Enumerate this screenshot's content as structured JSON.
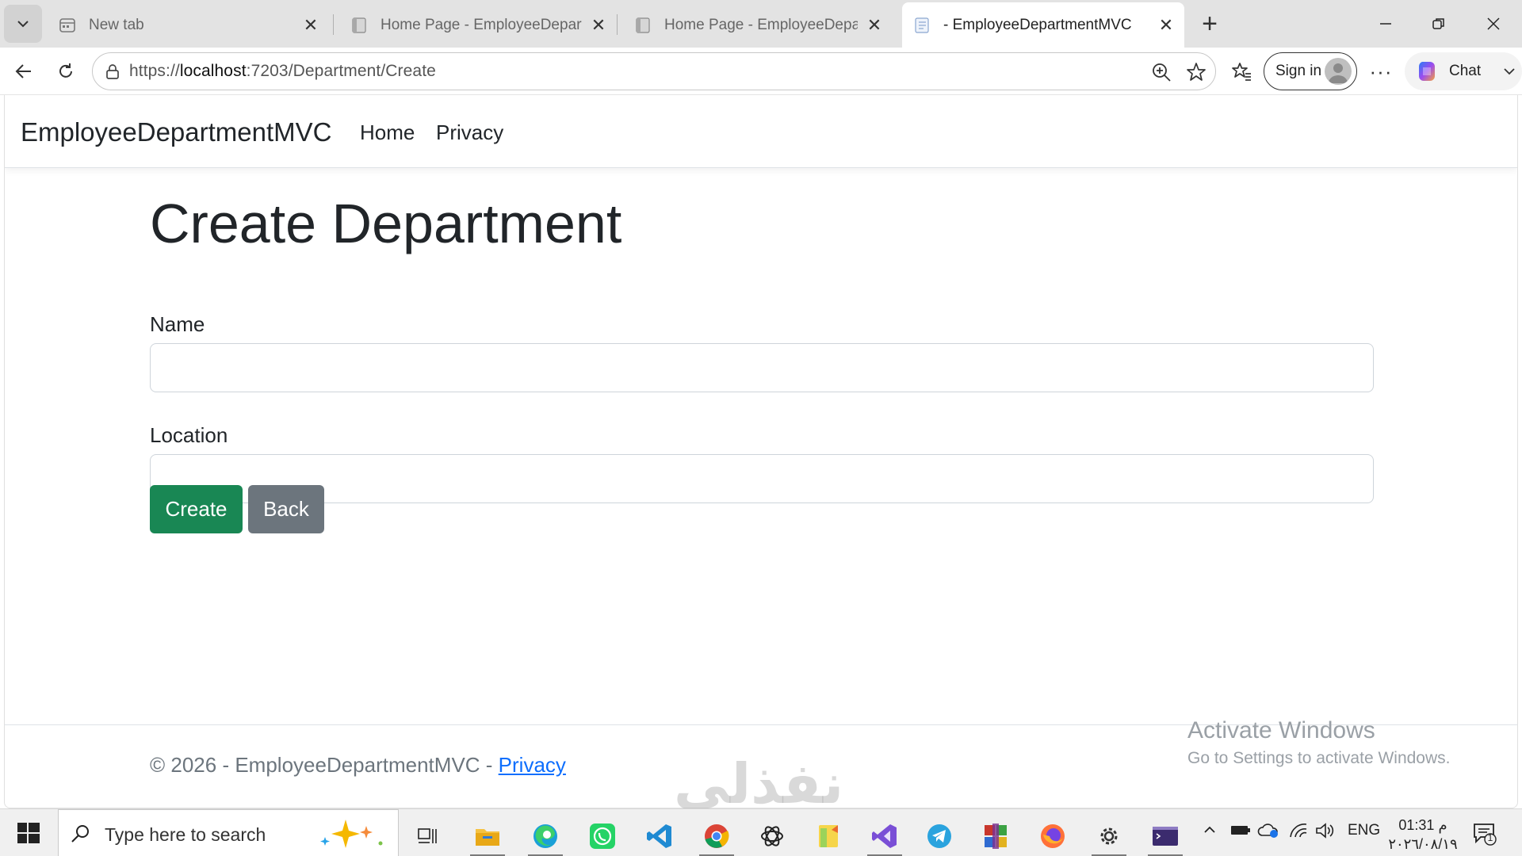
{
  "browser": {
    "tabs": [
      {
        "title": "New tab",
        "active": false
      },
      {
        "title": "Home Page - EmployeeDepartmentMVC",
        "active": false
      },
      {
        "title": "Home Page - EmployeeDepartmentMVC",
        "active": false
      },
      {
        "title": "- EmployeeDepartmentMVC",
        "active": true
      }
    ],
    "url_scheme": "https://",
    "url_host": "localhost",
    "url_rest": ":7203/Department/Create",
    "signin_label": "Sign in",
    "chat_label": "Chat"
  },
  "site": {
    "brand": "EmployeeDepartmentMVC",
    "nav": [
      {
        "label": "Home"
      },
      {
        "label": "Privacy"
      }
    ]
  },
  "form": {
    "title": "Create Department",
    "name_label": "Name",
    "name_value": "",
    "location_label": "Location",
    "location_value": "",
    "create_label": "Create",
    "back_label": "Back"
  },
  "footer": {
    "text": "© 2026 - EmployeeDepartmentMVC - ",
    "privacy_link": "Privacy"
  },
  "activation": {
    "title": "Activate Windows",
    "subtitle": "Go to Settings to activate Windows."
  },
  "watermark": "نفذلي",
  "taskbar": {
    "search_placeholder": "Type here to search",
    "language": "ENG",
    "time": "01:31 م",
    "date": "٢٠٢٦/٠٨/١٩",
    "notification_count": "1"
  },
  "colors": {
    "create_button": "#198754",
    "back_button": "#6c757d",
    "link": "#0d6efd"
  }
}
